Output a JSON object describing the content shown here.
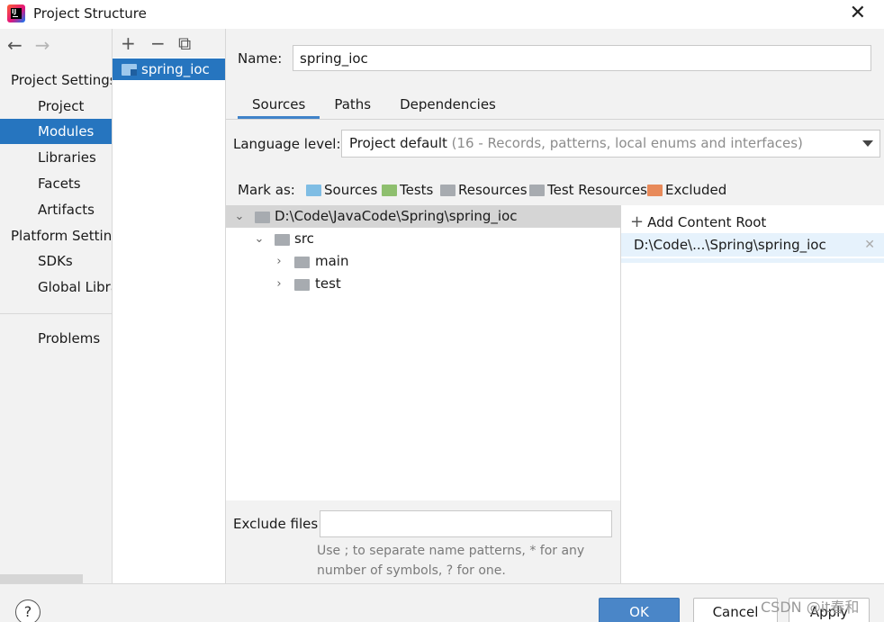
{
  "window": {
    "title": "Project Structure",
    "close": "✕"
  },
  "nav": {
    "back": "←",
    "forward": "→",
    "project_settings": "Project Settings",
    "project_items": [
      "Project",
      "Modules",
      "Libraries",
      "Facets",
      "Artifacts"
    ],
    "platform_settings": "Platform Settings",
    "platform_items": [
      "SDKs",
      "Global Libraries"
    ],
    "problems": "Problems",
    "selected": "Modules"
  },
  "modules": {
    "toolbar": {
      "add": "+",
      "remove": "−",
      "copy": "⧉"
    },
    "items": [
      "spring_ioc"
    ]
  },
  "module": {
    "name_label": "Name:",
    "name_value": "spring_ioc",
    "tabs": [
      "Sources",
      "Paths",
      "Dependencies"
    ],
    "active_tab": "Sources",
    "language_label": "Language level:",
    "language_value": "Project default",
    "language_hint": "(16 - Records, patterns, local enums and interfaces)",
    "mark_as_label": "Mark as:",
    "mark_as": [
      {
        "label": "Sources",
        "color": "#7fbde4"
      },
      {
        "label": "Tests",
        "color": "#8ebf6e"
      },
      {
        "label": "Resources",
        "color": "#a7abb0"
      },
      {
        "label": "Test Resources",
        "color": "#a7abb0"
      },
      {
        "label": "Excluded",
        "color": "#e88a5a"
      }
    ]
  },
  "tree": {
    "root": "D:\\Code\\JavaCode\\Spring\\spring_ioc",
    "src": "src",
    "main": "main",
    "test": "test"
  },
  "content_roots": {
    "add_label": "Add Content Root",
    "entry": "D:\\Code\\...\\Spring\\spring_ioc"
  },
  "exclude": {
    "label": "Exclude files:",
    "value": "",
    "hint": "Use ; to separate name patterns, * for any number of symbols, ? for one."
  },
  "footer": {
    "help": "?",
    "ok": "OK",
    "cancel": "Cancel",
    "apply": "Apply",
    "watermark": "CSDN @it春和"
  },
  "colors": {
    "selection": "#2675bf",
    "ok_button": "#4a86c8",
    "accent_tab": "#4083c9"
  }
}
